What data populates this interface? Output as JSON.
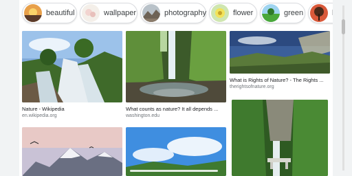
{
  "chips": [
    {
      "label": "beautiful",
      "icon": "beautiful-thumb-icon"
    },
    {
      "label": "wallpaper",
      "icon": "wallpaper-thumb-icon"
    },
    {
      "label": "photography",
      "icon": "photography-thumb-icon"
    },
    {
      "label": "flower",
      "icon": "flower-thumb-icon"
    },
    {
      "label": "green",
      "icon": "green-thumb-icon"
    },
    {
      "label": "l",
      "icon": "tree-thumb-icon"
    }
  ],
  "results": [
    {
      "title": "Nature - Wikipedia",
      "source": "en.wikipedia.org"
    },
    {
      "title": "What counts as nature? It all depends ...",
      "source": "washington.edu"
    },
    {
      "title": "What is Rights of Nature? - The Rights ...",
      "source": "therightsofnature.org"
    },
    {
      "title": "",
      "source": ""
    },
    {
      "title": "",
      "source": ""
    },
    {
      "title": "",
      "source": ""
    }
  ],
  "colors": {
    "page_bg": "#ffffff",
    "gutter": "#f1f3f4",
    "title": "#202124",
    "source": "#70757a"
  }
}
